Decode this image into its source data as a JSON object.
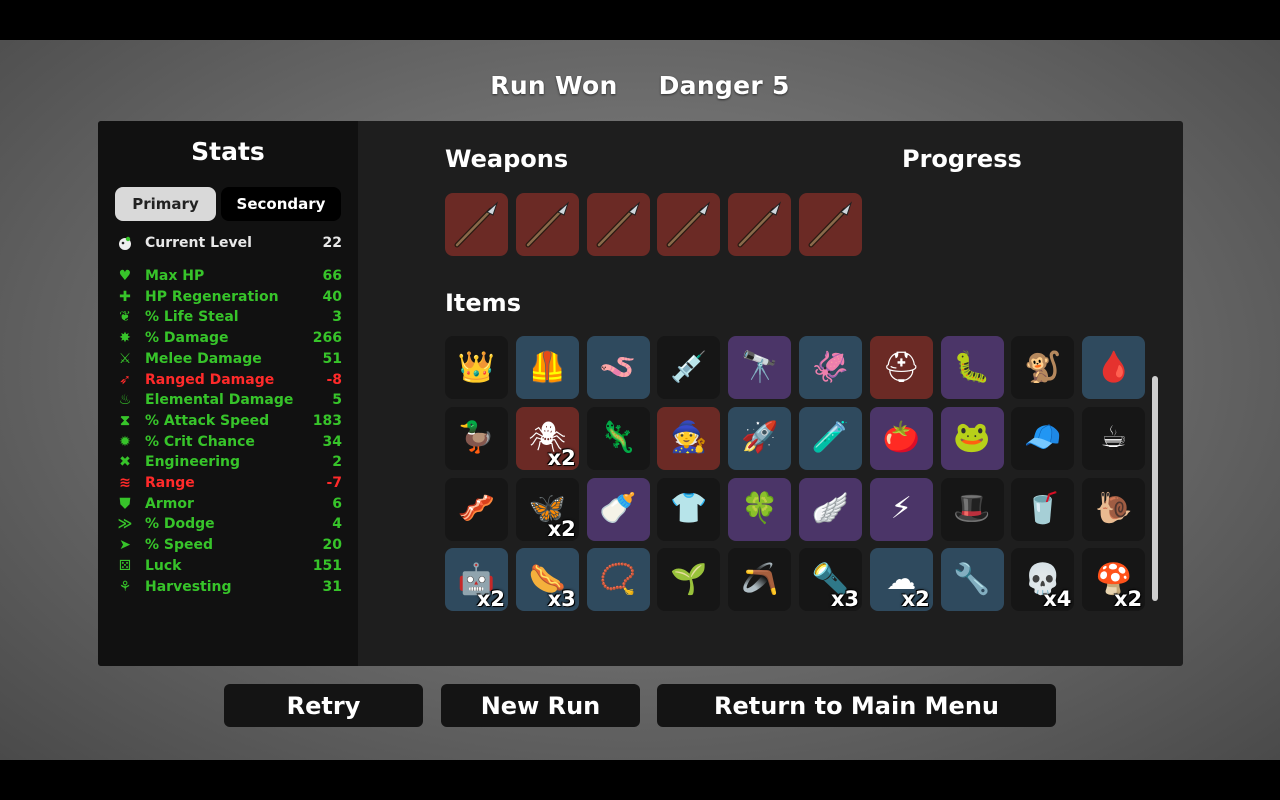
{
  "header": {
    "result": "Run Won",
    "danger": "Danger 5"
  },
  "stats": {
    "title": "Stats",
    "tabs": {
      "primary": "Primary",
      "secondary": "Secondary"
    },
    "level": {
      "label": "Current Level",
      "value": "22"
    },
    "rows": [
      {
        "label": "Max HP",
        "value": "66",
        "color": "#37c42a",
        "icon": "heart-icon"
      },
      {
        "label": "HP Regeneration",
        "value": "40",
        "color": "#37c42a",
        "icon": "hp-regen-icon"
      },
      {
        "label": "% Life Steal",
        "value": "3",
        "color": "#37c42a",
        "icon": "life-steal-icon"
      },
      {
        "label": "% Damage",
        "value": "266",
        "color": "#37c42a",
        "icon": "damage-icon"
      },
      {
        "label": "Melee Damage",
        "value": "51",
        "color": "#37c42a",
        "icon": "melee-icon"
      },
      {
        "label": "Ranged Damage",
        "value": "-8",
        "color": "#ff2a2a",
        "icon": "ranged-icon"
      },
      {
        "label": "Elemental Damage",
        "value": "5",
        "color": "#37c42a",
        "icon": "elemental-icon"
      },
      {
        "label": "% Attack Speed",
        "value": "183",
        "color": "#37c42a",
        "icon": "attack-speed-icon"
      },
      {
        "label": "% Crit Chance",
        "value": "34",
        "color": "#37c42a",
        "icon": "crit-icon"
      },
      {
        "label": "Engineering",
        "value": "2",
        "color": "#37c42a",
        "icon": "engineering-icon"
      },
      {
        "label": "Range",
        "value": "-7",
        "color": "#ff2a2a",
        "icon": "range-icon"
      },
      {
        "label": "Armor",
        "value": "6",
        "color": "#37c42a",
        "icon": "armor-icon"
      },
      {
        "label": "% Dodge",
        "value": "4",
        "color": "#37c42a",
        "icon": "dodge-icon"
      },
      {
        "label": "% Speed",
        "value": "20",
        "color": "#37c42a",
        "icon": "speed-icon"
      },
      {
        "label": "Luck",
        "value": "151",
        "color": "#37c42a",
        "icon": "luck-icon"
      },
      {
        "label": "Harvesting",
        "value": "31",
        "color": "#37c42a",
        "icon": "harvesting-icon"
      }
    ]
  },
  "weapons": {
    "title": "Weapons",
    "count": 6,
    "icon": "spear-icon"
  },
  "progress": {
    "title": "Progress"
  },
  "items": {
    "title": "Items",
    "list": [
      {
        "icon": "egg-king-icon",
        "glyph": "👑",
        "tier": "black",
        "count": ""
      },
      {
        "icon": "leather-vest-icon",
        "glyph": "🦺",
        "tier": "blue",
        "count": ""
      },
      {
        "icon": "worm-icon",
        "glyph": "🪱",
        "tier": "blue",
        "count": ""
      },
      {
        "icon": "syringe-icon",
        "glyph": "💉",
        "tier": "black",
        "count": ""
      },
      {
        "icon": "cannon-icon",
        "glyph": "🔭",
        "tier": "purple",
        "count": ""
      },
      {
        "icon": "tentacle-icon",
        "glyph": "🦑",
        "tier": "blue",
        "count": ""
      },
      {
        "icon": "medkit-icon",
        "glyph": "⛑",
        "tier": "red",
        "count": ""
      },
      {
        "icon": "tardigrade-icon",
        "glyph": "🐛",
        "tier": "purple",
        "count": ""
      },
      {
        "icon": "monkey-icon",
        "glyph": "🐒",
        "tier": "black",
        "count": ""
      },
      {
        "icon": "leech-icon",
        "glyph": "🩸",
        "tier": "blue",
        "count": ""
      },
      {
        "icon": "duck-icon",
        "glyph": "🦆",
        "tier": "black",
        "count": ""
      },
      {
        "icon": "spider-icon",
        "glyph": "🕷",
        "tier": "red",
        "count": "x2"
      },
      {
        "icon": "lizard-icon",
        "glyph": "🦎",
        "tier": "black",
        "count": ""
      },
      {
        "icon": "gnome-icon",
        "glyph": "🧙",
        "tier": "red",
        "count": ""
      },
      {
        "icon": "bullet-icon",
        "glyph": "🚀",
        "tier": "blue",
        "count": ""
      },
      {
        "icon": "potion-icon",
        "glyph": "🧪",
        "tier": "blue",
        "count": ""
      },
      {
        "icon": "tomato-icon",
        "glyph": "🍅",
        "tier": "purple",
        "count": ""
      },
      {
        "icon": "fairy-frog-icon",
        "glyph": "🐸",
        "tier": "purple",
        "count": ""
      },
      {
        "icon": "propeller-hat-icon",
        "glyph": "🧢",
        "tier": "black",
        "count": ""
      },
      {
        "icon": "coffee-icon",
        "glyph": "☕",
        "tier": "black",
        "count": ""
      },
      {
        "icon": "bacon-icon",
        "glyph": "🥓",
        "tier": "black",
        "count": ""
      },
      {
        "icon": "butterfly-icon",
        "glyph": "🦋",
        "tier": "black",
        "count": "x2"
      },
      {
        "icon": "baby-bottle-icon",
        "glyph": "🍼",
        "tier": "purple",
        "count": ""
      },
      {
        "icon": "plaid-shirt-icon",
        "glyph": "👕",
        "tier": "black",
        "count": ""
      },
      {
        "icon": "clover-icon",
        "glyph": "🍀",
        "tier": "purple",
        "count": ""
      },
      {
        "icon": "wings-icon",
        "glyph": "🪽",
        "tier": "purple",
        "count": ""
      },
      {
        "icon": "claw-marks-icon",
        "glyph": "⚡",
        "tier": "purple",
        "count": ""
      },
      {
        "icon": "bowler-hat-icon",
        "glyph": "🎩",
        "tier": "black",
        "count": ""
      },
      {
        "icon": "lemonade-icon",
        "glyph": "🥤",
        "tier": "black",
        "count": ""
      },
      {
        "icon": "snail-icon",
        "glyph": "🐌",
        "tier": "black",
        "count": ""
      },
      {
        "icon": "robot-icon",
        "glyph": "🤖",
        "tier": "blue",
        "count": "x2"
      },
      {
        "icon": "sausage-icon",
        "glyph": "🌭",
        "tier": "blue",
        "count": "x3"
      },
      {
        "icon": "amulet-icon",
        "glyph": "📿",
        "tier": "blue",
        "count": ""
      },
      {
        "icon": "sprout-icon",
        "glyph": "🌱",
        "tier": "black",
        "count": ""
      },
      {
        "icon": "shield-ring-icon",
        "glyph": "🪃",
        "tier": "black",
        "count": ""
      },
      {
        "icon": "turret-icon",
        "glyph": "🔦",
        "tier": "black",
        "count": "x3"
      },
      {
        "icon": "cloud-blob-icon",
        "glyph": "☁",
        "tier": "blue",
        "count": "x2"
      },
      {
        "icon": "metal-detector-icon",
        "glyph": "🔧",
        "tier": "blue",
        "count": ""
      },
      {
        "icon": "skull-icon",
        "glyph": "💀",
        "tier": "black",
        "count": "x4"
      },
      {
        "icon": "mushroom-icon",
        "glyph": "🍄",
        "tier": "black",
        "count": "x2"
      }
    ]
  },
  "buttons": {
    "retry": "Retry",
    "new_run": "New Run",
    "main_menu": "Return to Main Menu"
  }
}
